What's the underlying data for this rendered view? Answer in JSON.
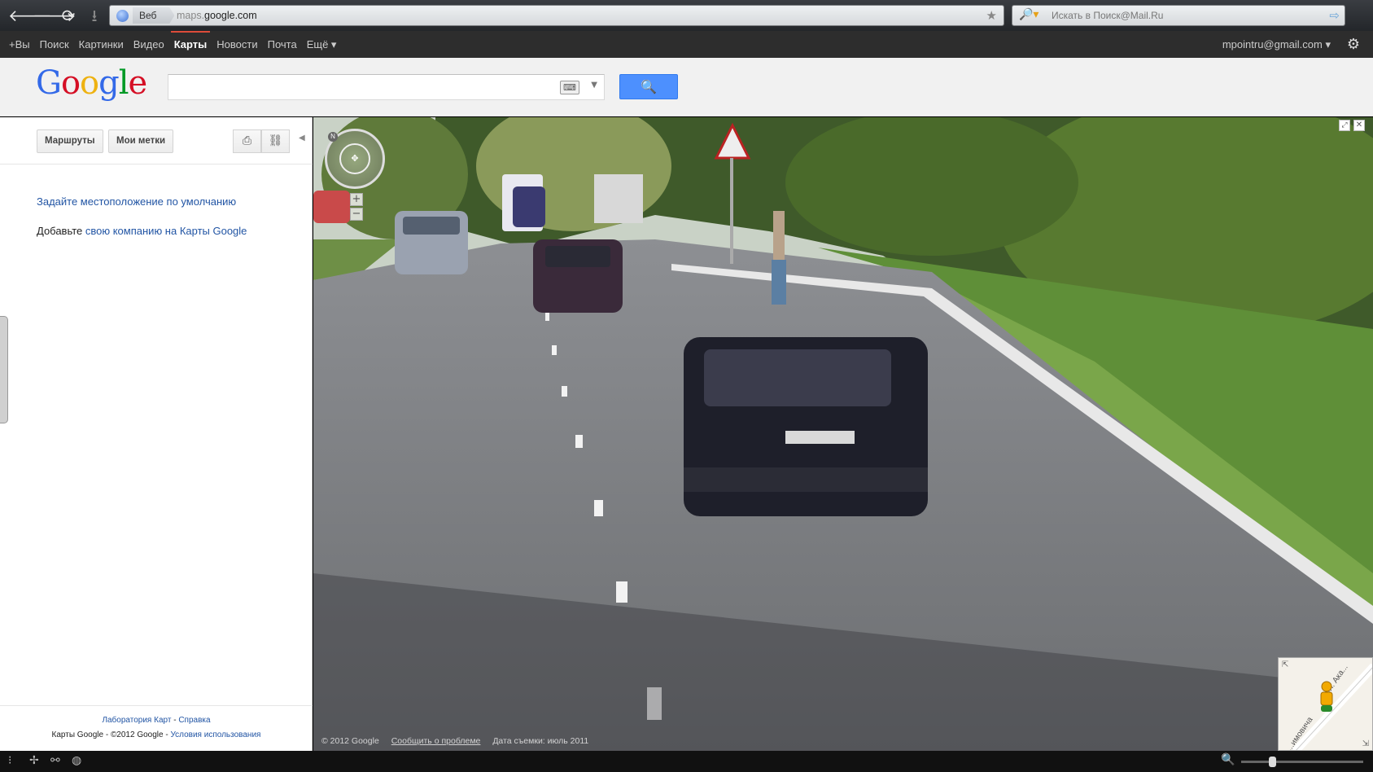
{
  "browser": {
    "back": "🡐",
    "forward": "🡒",
    "reload": "⟳",
    "download": "⭳",
    "url_tag": "Веб",
    "url_prefix": "maps.",
    "url_domain": "google.com",
    "search_placeholder": "Искать в Поиск@Mail.Ru"
  },
  "gbar": {
    "links": [
      "+Вы",
      "Поиск",
      "Картинки",
      "Видео",
      "Карты",
      "Новости",
      "Почта",
      "Ещё ▾"
    ],
    "active_index": 4,
    "account": "mpointru@gmail.com ▾"
  },
  "header": {
    "logo_letters": [
      "G",
      "o",
      "o",
      "g",
      "l",
      "e"
    ],
    "logo_colors": [
      "#3369e8",
      "#d50f25",
      "#eeb211",
      "#3369e8",
      "#009925",
      "#d50f25"
    ],
    "search_value": ""
  },
  "left": {
    "buttons": [
      "Маршруты",
      "Мои метки"
    ],
    "default_location_link": "Задайте местоположение по умолчанию",
    "add_company_prefix": "Добавьте ",
    "add_company_link": "свою компанию на Карты Google",
    "footer": {
      "lab": "Лаборатория Карт",
      "sep": " - ",
      "help": "Справка",
      "copyright": "Карты Google - ©2012 Google - ",
      "terms": "Условия использования"
    }
  },
  "streetview": {
    "copyright": "© 2012 Google",
    "report": "Сообщить о проблеме",
    "capture_date": "Дата съемки: июль 2011",
    "minimap_road1": "ул. Ака...",
    "minimap_road2": "...имовича",
    "zoom_plus": "+",
    "zoom_minus": "−"
  },
  "taskbar": {
    "zoom_level": 0.25
  },
  "colors": {
    "accent": "#dd4b39",
    "link": "#2255a4",
    "search_button": "#4d90fe"
  }
}
